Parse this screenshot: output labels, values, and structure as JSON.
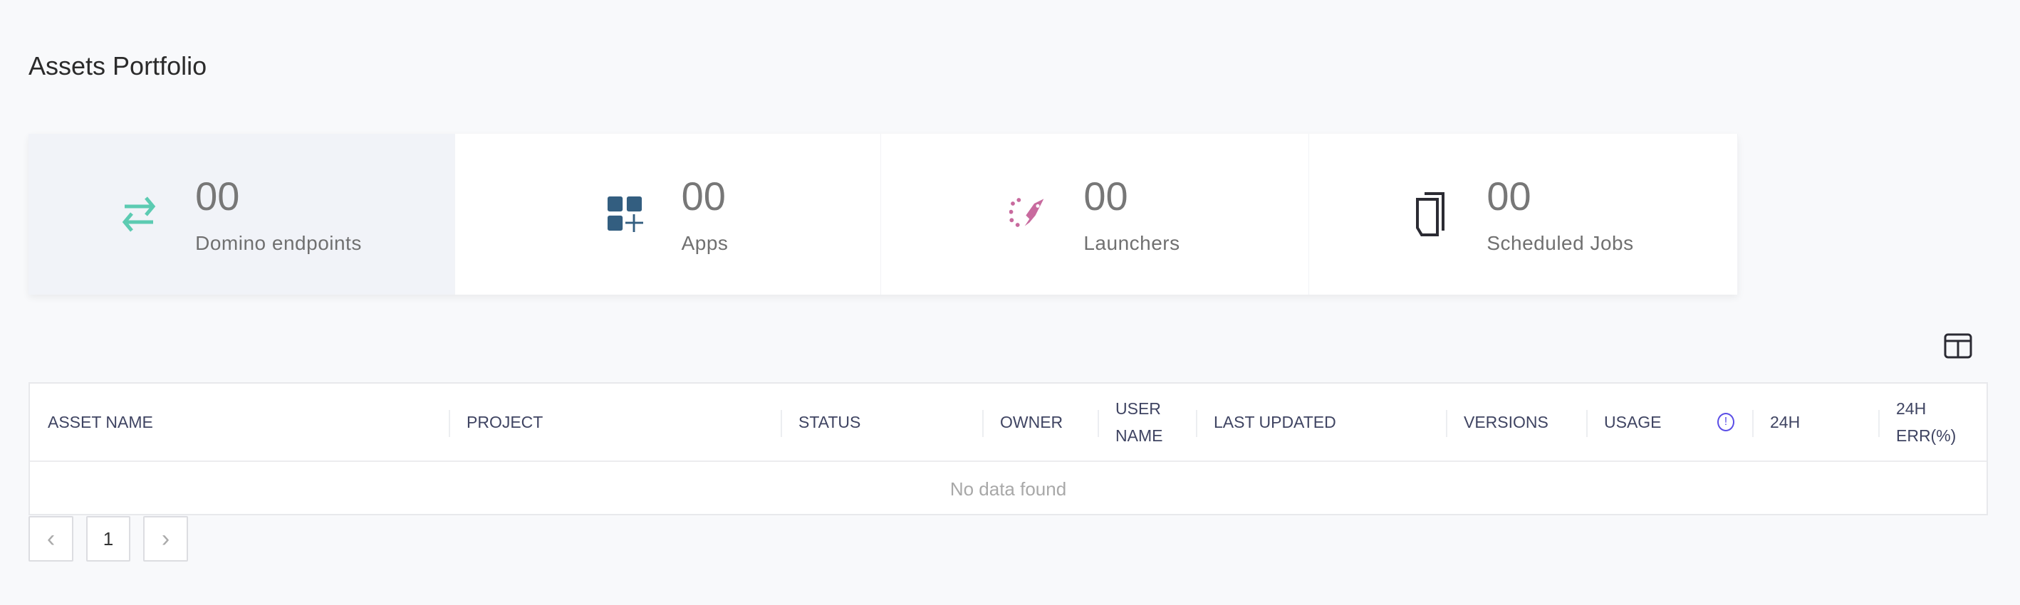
{
  "page": {
    "title": "Assets Portfolio"
  },
  "cards": [
    {
      "value": "00",
      "label": "Domino endpoints",
      "icon": "arrows-swap-icon",
      "color": "#5ccbb2"
    },
    {
      "value": "00",
      "label": "Apps",
      "icon": "apps-add-icon",
      "color": "#335e80"
    },
    {
      "value": "00",
      "label": "Launchers",
      "icon": "rocket-icon",
      "color": "#c86a9e"
    },
    {
      "value": "00",
      "label": "Scheduled Jobs",
      "icon": "copy-documents-icon",
      "color": "#2b2b33"
    }
  ],
  "table": {
    "columns": [
      "ASSET NAME",
      "PROJECT",
      "STATUS",
      "OWNER",
      "USER NAME",
      "LAST UPDATED",
      "VERSIONS",
      "USAGE",
      "24H",
      "24H ERR(%)"
    ],
    "usage_info_icon": "!",
    "empty_text": "No data found"
  },
  "pagination": {
    "prev": "‹",
    "current": "1",
    "next": "›"
  }
}
